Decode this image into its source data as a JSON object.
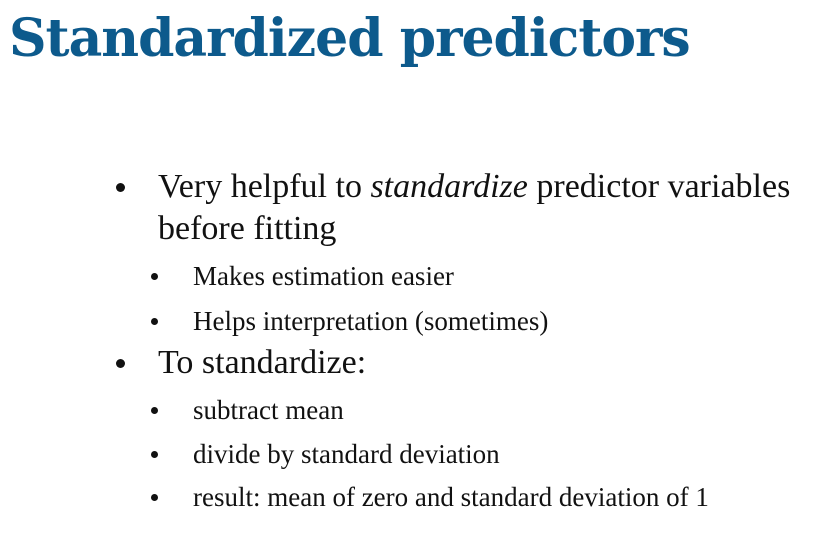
{
  "slide": {
    "title": "Standardized predictors",
    "bullets": [
      {
        "text_before": "Very helpful to ",
        "emphasis": "standardize",
        "text_after": " predictor variables",
        "continuation": "before fitting",
        "sub": [
          "Makes estimation easier",
          "Helps interpretation (sometimes)"
        ]
      },
      {
        "text": "To standardize:",
        "sub": [
          "subtract mean",
          "divide by standard deviation",
          "result: mean of zero and standard deviation of 1"
        ]
      }
    ]
  },
  "colors": {
    "title": "#0d5a8c",
    "text": "#111111"
  }
}
